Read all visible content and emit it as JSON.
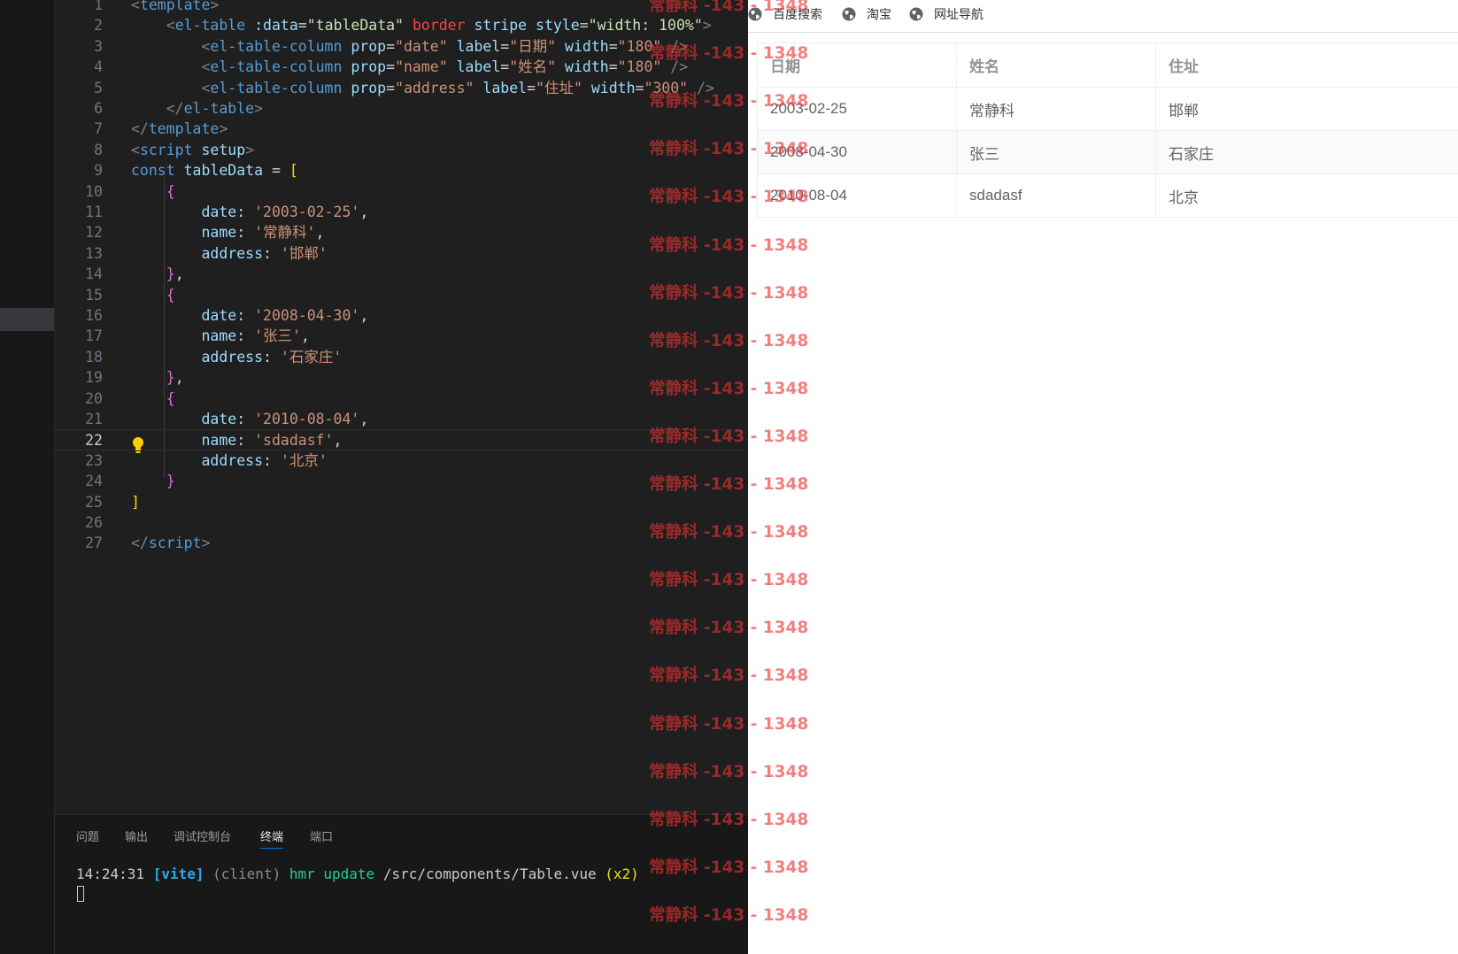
{
  "editor": {
    "lines": [
      {
        "n": "1",
        "tokens": [
          [
            "punc",
            "<"
          ],
          [
            "tag",
            "template"
          ],
          [
            "punc",
            ">"
          ]
        ]
      },
      {
        "n": "2",
        "tokens": [
          [
            "plain",
            "    "
          ],
          [
            "punc",
            "<"
          ],
          [
            "tag",
            "el-table"
          ],
          [
            "plain",
            " "
          ],
          [
            "attr",
            ":data"
          ],
          [
            "plain",
            "="
          ],
          [
            "mix",
            "\"tableData\""
          ],
          [
            "plain",
            " "
          ],
          [
            "dir",
            "border"
          ],
          [
            "plain",
            " "
          ],
          [
            "attr",
            "stripe"
          ],
          [
            "plain",
            " "
          ],
          [
            "attr",
            "style"
          ],
          [
            "plain",
            "="
          ],
          [
            "mix",
            "\"width: 100%\""
          ],
          [
            "punc",
            ">"
          ]
        ]
      },
      {
        "n": "3",
        "tokens": [
          [
            "plain",
            "        "
          ],
          [
            "punc",
            "<"
          ],
          [
            "tag",
            "el-table-column"
          ],
          [
            "plain",
            " "
          ],
          [
            "attr",
            "prop"
          ],
          [
            "plain",
            "="
          ],
          [
            "str",
            "\"date\""
          ],
          [
            "plain",
            " "
          ],
          [
            "attr",
            "label"
          ],
          [
            "plain",
            "="
          ],
          [
            "str",
            "\"日期\""
          ],
          [
            "plain",
            " "
          ],
          [
            "attr",
            "width"
          ],
          [
            "plain",
            "="
          ],
          [
            "str",
            "\"180\""
          ],
          [
            "plain",
            " "
          ],
          [
            "punc",
            "/>"
          ]
        ]
      },
      {
        "n": "4",
        "tokens": [
          [
            "plain",
            "        "
          ],
          [
            "punc",
            "<"
          ],
          [
            "tag",
            "el-table-column"
          ],
          [
            "plain",
            " "
          ],
          [
            "attr",
            "prop"
          ],
          [
            "plain",
            "="
          ],
          [
            "str",
            "\"name\""
          ],
          [
            "plain",
            " "
          ],
          [
            "attr",
            "label"
          ],
          [
            "plain",
            "="
          ],
          [
            "str",
            "\"姓名\""
          ],
          [
            "plain",
            " "
          ],
          [
            "attr",
            "width"
          ],
          [
            "plain",
            "="
          ],
          [
            "str",
            "\"180\""
          ],
          [
            "plain",
            " "
          ],
          [
            "punc",
            "/>"
          ]
        ]
      },
      {
        "n": "5",
        "tokens": [
          [
            "plain",
            "        "
          ],
          [
            "punc",
            "<"
          ],
          [
            "tag",
            "el-table-column"
          ],
          [
            "plain",
            " "
          ],
          [
            "attr",
            "prop"
          ],
          [
            "plain",
            "="
          ],
          [
            "str",
            "\"address\""
          ],
          [
            "plain",
            " "
          ],
          [
            "attr",
            "label"
          ],
          [
            "plain",
            "="
          ],
          [
            "str",
            "\"住址\""
          ],
          [
            "plain",
            " "
          ],
          [
            "attr",
            "width"
          ],
          [
            "plain",
            "="
          ],
          [
            "str",
            "\"300\""
          ],
          [
            "plain",
            " "
          ],
          [
            "punc",
            "/>"
          ]
        ]
      },
      {
        "n": "6",
        "tokens": [
          [
            "plain",
            "    "
          ],
          [
            "punc",
            "</"
          ],
          [
            "tag",
            "el-table"
          ],
          [
            "punc",
            ">"
          ]
        ]
      },
      {
        "n": "7",
        "tokens": [
          [
            "punc",
            "</"
          ],
          [
            "tag",
            "template"
          ],
          [
            "punc",
            ">"
          ]
        ]
      },
      {
        "n": "8",
        "tokens": [
          [
            "punc",
            "<"
          ],
          [
            "tag",
            "script"
          ],
          [
            "plain",
            " "
          ],
          [
            "attr",
            "setup"
          ],
          [
            "punc",
            ">"
          ]
        ]
      },
      {
        "n": "9",
        "tokens": [
          [
            "kw",
            "const"
          ],
          [
            "plain",
            " "
          ],
          [
            "var",
            "tableData"
          ],
          [
            "plain",
            " = "
          ],
          [
            "br1",
            "["
          ]
        ]
      },
      {
        "n": "10",
        "tokens": [
          [
            "plain",
            "    "
          ],
          [
            "br2",
            "{"
          ]
        ]
      },
      {
        "n": "11",
        "tokens": [
          [
            "plain",
            "        "
          ],
          [
            "var",
            "date"
          ],
          [
            "plain",
            ": "
          ],
          [
            "str",
            "'2003-02-25'"
          ],
          [
            "plain",
            ","
          ]
        ]
      },
      {
        "n": "12",
        "tokens": [
          [
            "plain",
            "        "
          ],
          [
            "var",
            "name"
          ],
          [
            "plain",
            ": "
          ],
          [
            "str",
            "'常静科'"
          ],
          [
            "plain",
            ","
          ]
        ]
      },
      {
        "n": "13",
        "tokens": [
          [
            "plain",
            "        "
          ],
          [
            "var",
            "address"
          ],
          [
            "plain",
            ": "
          ],
          [
            "str",
            "'邯郸'"
          ]
        ]
      },
      {
        "n": "14",
        "tokens": [
          [
            "plain",
            "    "
          ],
          [
            "br2",
            "}"
          ],
          [
            "plain",
            ","
          ]
        ]
      },
      {
        "n": "15",
        "tokens": [
          [
            "plain",
            "    "
          ],
          [
            "br2",
            "{"
          ]
        ]
      },
      {
        "n": "16",
        "tokens": [
          [
            "plain",
            "        "
          ],
          [
            "var",
            "date"
          ],
          [
            "plain",
            ": "
          ],
          [
            "str",
            "'2008-04-30'"
          ],
          [
            "plain",
            ","
          ]
        ]
      },
      {
        "n": "17",
        "tokens": [
          [
            "plain",
            "        "
          ],
          [
            "var",
            "name"
          ],
          [
            "plain",
            ": "
          ],
          [
            "str",
            "'张三'"
          ],
          [
            "plain",
            ","
          ]
        ]
      },
      {
        "n": "18",
        "tokens": [
          [
            "plain",
            "        "
          ],
          [
            "var",
            "address"
          ],
          [
            "plain",
            ": "
          ],
          [
            "str",
            "'石家庄'"
          ]
        ]
      },
      {
        "n": "19",
        "tokens": [
          [
            "plain",
            "    "
          ],
          [
            "br2",
            "}"
          ],
          [
            "plain",
            ","
          ]
        ]
      },
      {
        "n": "20",
        "tokens": [
          [
            "plain",
            "    "
          ],
          [
            "br2",
            "{"
          ]
        ]
      },
      {
        "n": "21",
        "tokens": [
          [
            "plain",
            "        "
          ],
          [
            "var",
            "date"
          ],
          [
            "plain",
            ": "
          ],
          [
            "str",
            "'2010-08-04'"
          ],
          [
            "plain",
            ","
          ]
        ]
      },
      {
        "n": "22",
        "tokens": [
          [
            "plain",
            "        "
          ],
          [
            "var",
            "name"
          ],
          [
            "plain",
            ": "
          ],
          [
            "str",
            "'sdadasf'"
          ],
          [
            "plain",
            ","
          ]
        ]
      },
      {
        "n": "23",
        "tokens": [
          [
            "plain",
            "        "
          ],
          [
            "var",
            "address"
          ],
          [
            "plain",
            ": "
          ],
          [
            "str",
            "'北京'"
          ]
        ]
      },
      {
        "n": "24",
        "tokens": [
          [
            "plain",
            "    "
          ],
          [
            "br2",
            "}"
          ]
        ]
      },
      {
        "n": "25",
        "tokens": [
          [
            "br1",
            "]"
          ]
        ]
      },
      {
        "n": "26",
        "tokens": []
      },
      {
        "n": "27",
        "tokens": [
          [
            "punc",
            "</"
          ],
          [
            "tag",
            "script"
          ],
          [
            "punc",
            ">"
          ]
        ]
      }
    ],
    "active_line": "22"
  },
  "panel": {
    "tabs": [
      "问题",
      "输出",
      "调试控制台",
      "终端",
      "端口"
    ],
    "active_tab": "终端",
    "terminal": {
      "time": "14:24:31",
      "tag": "[vite]",
      "client": "(client)",
      "action": "hmr update",
      "path": "/src/components/Table.vue",
      "count": "(x2)"
    }
  },
  "browser": {
    "bookmarks": [
      {
        "label": "百度搜索",
        "icon": "globe-icon"
      },
      {
        "label": "淘宝",
        "icon": "globe-icon"
      },
      {
        "label": "网址导航",
        "icon": "globe-icon"
      }
    ],
    "table": {
      "headers": [
        "日期",
        "姓名",
        "住址"
      ],
      "rows": [
        [
          "2003-02-25",
          "常静科",
          "邯郸"
        ],
        [
          "2008-04-30",
          "张三",
          "石家庄"
        ],
        [
          "2010-08-04",
          "sdadasf",
          "北京"
        ]
      ]
    }
  },
  "watermark": {
    "text": "常静科 -143 - 1348",
    "count": 20
  },
  "colors": {
    "editor_bg": "#1f1f1f",
    "watermark": "#e63232",
    "active_tab_underline": "#0078d4"
  }
}
